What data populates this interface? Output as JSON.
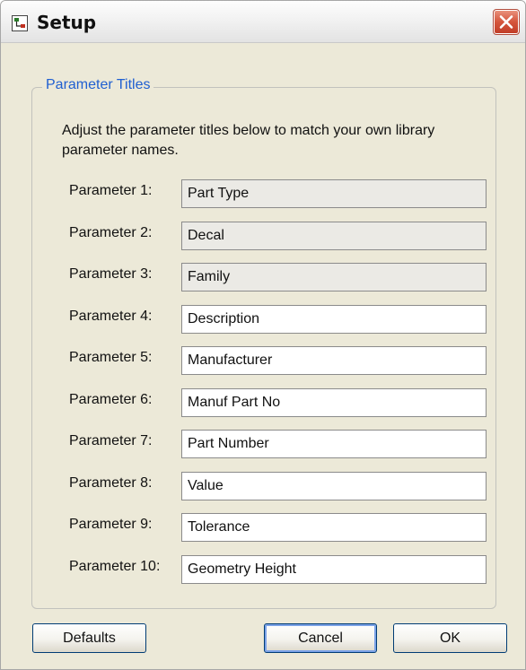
{
  "window": {
    "title": "Setup",
    "icon": "setup-app-icon",
    "close_icon": "close-x-icon"
  },
  "group": {
    "label": "Parameter Titles",
    "instructions": "Adjust the parameter titles below to match your own library parameter names."
  },
  "parameters": [
    {
      "label": "Parameter 1:",
      "value": "Part Type",
      "editable": false
    },
    {
      "label": "Parameter 2:",
      "value": "Decal",
      "editable": false
    },
    {
      "label": "Parameter 3:",
      "value": "Family",
      "editable": false
    },
    {
      "label": "Parameter 4:",
      "value": "Description",
      "editable": true
    },
    {
      "label": "Parameter 5:",
      "value": "Manufacturer",
      "editable": true
    },
    {
      "label": "Parameter 6:",
      "value": "Manuf Part No",
      "editable": true
    },
    {
      "label": "Parameter 7:",
      "value": "Part Number",
      "editable": true
    },
    {
      "label": "Parameter 8:",
      "value": "Value",
      "editable": true
    },
    {
      "label": "Parameter 9:",
      "value": "Tolerance",
      "editable": true
    },
    {
      "label": "Parameter 10:",
      "value": "Geometry Height",
      "editable": true
    }
  ],
  "buttons": {
    "defaults": "Defaults",
    "cancel": "Cancel",
    "ok": "OK"
  },
  "colors": {
    "dialog_bg": "#ece9d8",
    "group_label": "#1f5fd1",
    "readonly_field": "#ebeae5",
    "close_button": "#d5553c"
  }
}
